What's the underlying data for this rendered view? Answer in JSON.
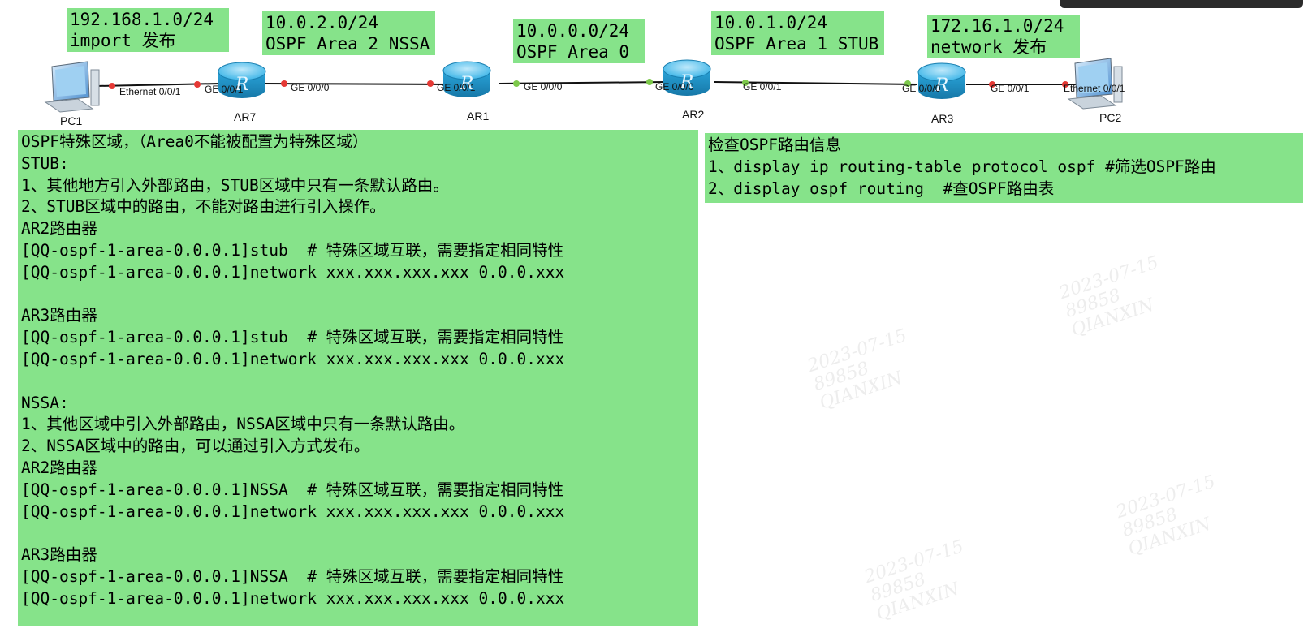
{
  "subnet_labels": [
    {
      "line1": "192.168.1.0/24",
      "line2": "import 发布"
    },
    {
      "line1": "10.0.2.0/24",
      "line2": "OSPF Area 2 NSSA"
    },
    {
      "line1": "10.0.0.0/24",
      "line2": "OSPF Area 0"
    },
    {
      "line1": "10.0.1.0/24",
      "line2": "OSPF Area 1 STUB"
    },
    {
      "line1": "172.16.1.0/24",
      "line2": "network 发布"
    }
  ],
  "devices": {
    "pc1": "PC1",
    "ar7": "AR7",
    "ar1": "AR1",
    "ar2": "AR2",
    "ar3": "AR3",
    "pc2": "PC2"
  },
  "interfaces": {
    "pc1_eth": "Ethernet 0/0/1",
    "ar7_g1": "GE 0/0/1",
    "ar7_g0": "GE 0/0/0",
    "ar1_g1": "GE 0/0/1",
    "ar1_g0": "GE 0/0/0",
    "ar2_g0": "GE 0/0/0",
    "ar2_g1": "GE 0/0/1",
    "ar3_g0": "GE 0/0/0",
    "ar3_g1": "GE 0/0/1",
    "pc2_eth": "Ethernet 0/0/1"
  },
  "colors": {
    "note_green": "#86e38a",
    "link_red": "#e53935",
    "link_green": "#7cc84a",
    "router_blue": "#3fb6e8"
  },
  "notes": {
    "left": [
      "OSPF特殊区域，（Area0不能被配置为特殊区域）",
      "STUB:",
      "1、其他地方引入外部路由，STUB区域中只有一条默认路由。",
      "2、STUB区域中的路由，不能对路由进行引入操作。",
      "AR2路由器",
      "[QQ-ospf-1-area-0.0.0.1]stub  # 特殊区域互联，需要指定相同特性",
      "[QQ-ospf-1-area-0.0.0.1]network xxx.xxx.xxx.xxx 0.0.0.xxx",
      "",
      "AR3路由器",
      "[QQ-ospf-1-area-0.0.0.1]stub  # 特殊区域互联，需要指定相同特性",
      "[QQ-ospf-1-area-0.0.0.1]network xxx.xxx.xxx.xxx 0.0.0.xxx",
      "",
      "NSSA:",
      "1、其他区域中引入外部路由，NSSA区域中只有一条默认路由。",
      "2、NSSA区域中的路由，可以通过引入方式发布。",
      "AR2路由器",
      "[QQ-ospf-1-area-0.0.0.1]NSSA  # 特殊区域互联，需要指定相同特性",
      "[QQ-ospf-1-area-0.0.0.1]network xxx.xxx.xxx.xxx 0.0.0.xxx",
      "",
      "AR3路由器",
      "[QQ-ospf-1-area-0.0.0.1]NSSA  # 特殊区域互联，需要指定相同特性",
      "[QQ-ospf-1-area-0.0.0.1]network xxx.xxx.xxx.xxx 0.0.0.xxx"
    ],
    "right": [
      "检查OSPF路由信息",
      "1、display ip routing-table protocol ospf #筛选OSPF路由",
      "2、display ospf routing  #查OSPF路由表"
    ]
  },
  "watermark": {
    "date": "2023-07-15",
    "id": "89858",
    "name": "QIANXIN"
  }
}
